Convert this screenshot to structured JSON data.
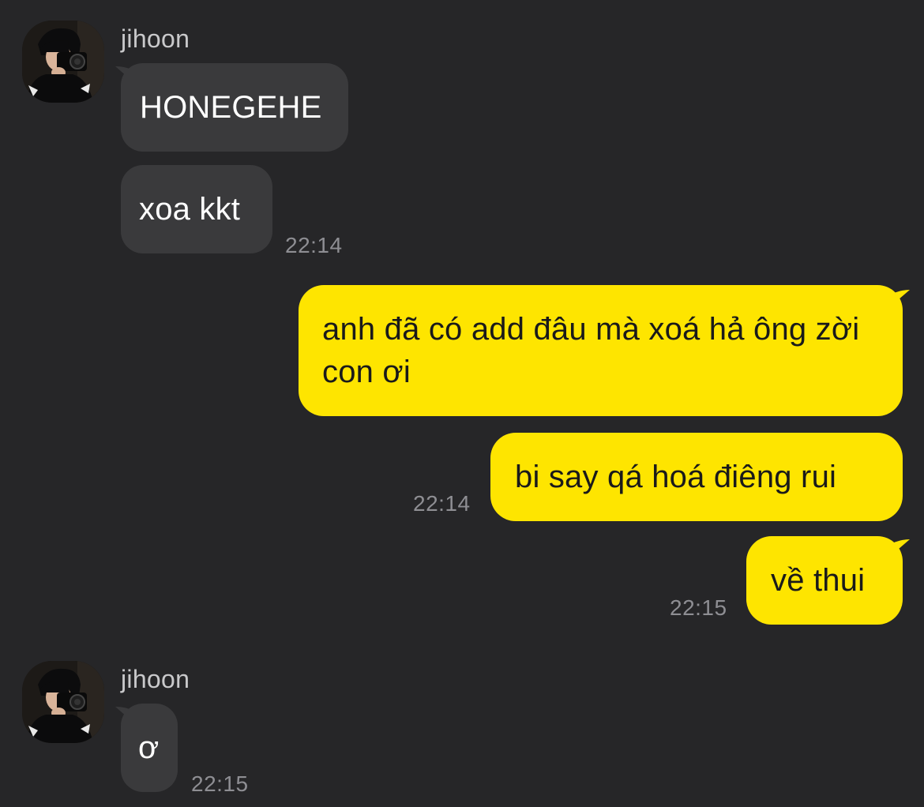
{
  "colors": {
    "background": "#262628",
    "incoming_bubble": "#3a3a3c",
    "outgoing_bubble": "#fee500",
    "timestamp": "#8e8e93",
    "sender_name": "#c9c9cb"
  },
  "groups": [
    {
      "sender": "jihoon",
      "avatar_icon": "profile-photo-camera",
      "messages": [
        "HONEGEHE",
        "xoa kkt"
      ],
      "time": "22:14"
    },
    {
      "sender": "me",
      "messages": [
        "anh đã có add đâu mà xoá hả ông zời con ơi",
        "bi say qá hoá điêng rui"
      ],
      "time": "22:14"
    },
    {
      "sender": "me",
      "messages": [
        "về thui"
      ],
      "time": "22:15"
    },
    {
      "sender": "jihoon",
      "avatar_icon": "profile-photo-camera",
      "messages": [
        "ơ"
      ],
      "time": "22:15"
    }
  ]
}
